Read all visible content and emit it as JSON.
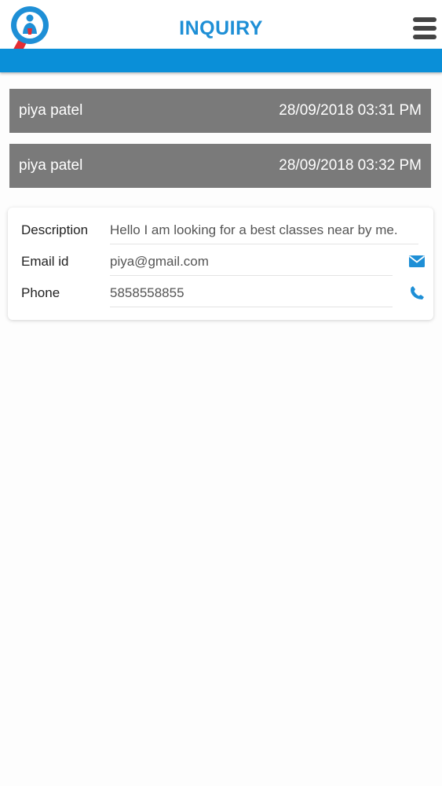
{
  "header": {
    "title": "INQUIRY",
    "accent_color": "#0a8fd8"
  },
  "inquiries": [
    {
      "name": "piya patel",
      "datetime": "28/09/2018 03:31 PM"
    },
    {
      "name": "piya patel",
      "datetime": "28/09/2018 03:32 PM"
    }
  ],
  "detail": {
    "description_label": "Description",
    "description_value": "Hello I am looking for a best classes near by me.",
    "email_label": "Email id",
    "email_value": "piya@gmail.com",
    "phone_label": "Phone",
    "phone_value": "5858558855",
    "email_icon": "mail-icon",
    "phone_icon": "phone-icon"
  }
}
